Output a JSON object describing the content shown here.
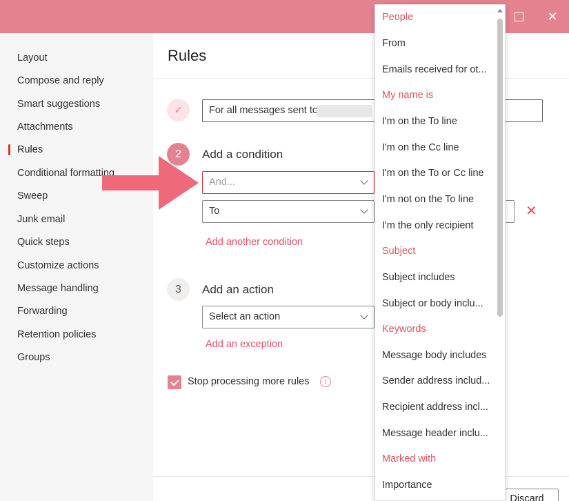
{
  "window": {
    "minimize_icon": "minimize-icon",
    "maximize_icon": "maximize-icon",
    "close_glyph": "✕"
  },
  "sidebar": {
    "items": [
      {
        "label": "Layout"
      },
      {
        "label": "Compose and reply"
      },
      {
        "label": "Smart suggestions"
      },
      {
        "label": "Attachments"
      },
      {
        "label": "Rules",
        "active": true
      },
      {
        "label": "Conditional formatting"
      },
      {
        "label": "Sweep"
      },
      {
        "label": "Junk email"
      },
      {
        "label": "Quick steps"
      },
      {
        "label": "Customize actions"
      },
      {
        "label": "Message handling"
      },
      {
        "label": "Forwarding"
      },
      {
        "label": "Retention policies"
      },
      {
        "label": "Groups"
      }
    ]
  },
  "main": {
    "title": "Rules",
    "step1": {
      "icon": "✓",
      "condition_text": "For all messages sent to"
    },
    "step2": {
      "number": "2",
      "label": "Add a condition",
      "condition_placeholder": "And...",
      "second_condition_value": "To",
      "add_condition_link": "Add another condition",
      "delete_glyph": "✕"
    },
    "step3": {
      "number": "3",
      "label": "Add an action",
      "action_placeholder": "Select an action",
      "add_exception_link": "Add an exception"
    },
    "stop_processing": {
      "checked": true,
      "label": "Stop processing more rules",
      "info_glyph": "i"
    },
    "footer": {
      "discard_label": "Discard"
    }
  },
  "dropdown": {
    "items": [
      {
        "label": "People",
        "type": "header"
      },
      {
        "label": "From",
        "type": "option"
      },
      {
        "label": "Emails received for ot...",
        "type": "option"
      },
      {
        "label": "My name is",
        "type": "header"
      },
      {
        "label": "I'm on the To line",
        "type": "option"
      },
      {
        "label": "I'm on the Cc line",
        "type": "option"
      },
      {
        "label": "I'm on the To or Cc line",
        "type": "option"
      },
      {
        "label": "I'm not on the To line",
        "type": "option"
      },
      {
        "label": "I'm the only recipient",
        "type": "option"
      },
      {
        "label": "Subject",
        "type": "header"
      },
      {
        "label": "Subject includes",
        "type": "option"
      },
      {
        "label": "Subject or body inclu...",
        "type": "option"
      },
      {
        "label": "Keywords",
        "type": "header"
      },
      {
        "label": "Message body includes",
        "type": "option"
      },
      {
        "label": "Sender address includ...",
        "type": "option"
      },
      {
        "label": "Recipient address incl...",
        "type": "option"
      },
      {
        "label": "Message header inclu...",
        "type": "option"
      },
      {
        "label": "Marked with",
        "type": "header"
      },
      {
        "label": "Importance",
        "type": "option"
      }
    ]
  },
  "colors": {
    "accent": "#e5828f",
    "accent_text": "#e0525f",
    "error_border": "#d13438",
    "arrow": "#ee6a7a"
  }
}
